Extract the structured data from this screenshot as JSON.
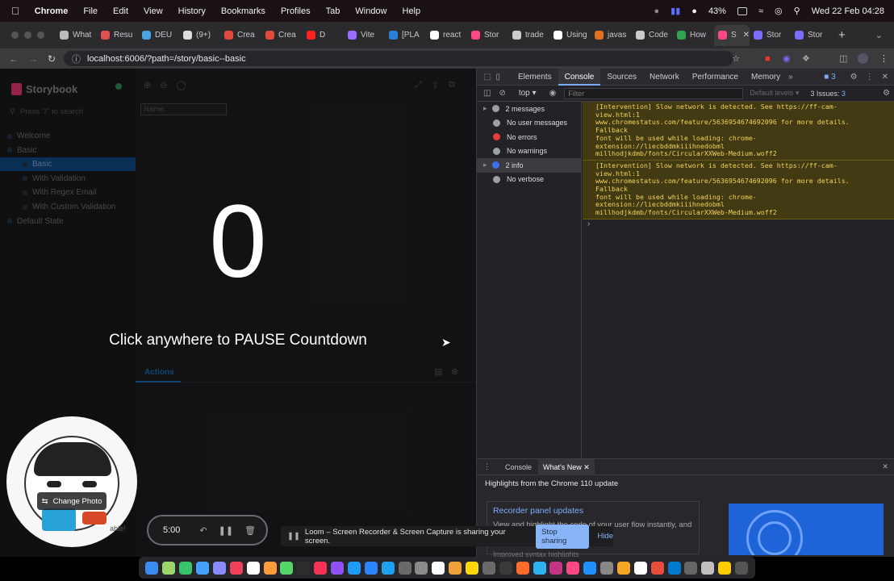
{
  "menubar": {
    "items": [
      "Chrome",
      "File",
      "Edit",
      "View",
      "History",
      "Bookmarks",
      "Profiles",
      "Tab",
      "Window",
      "Help"
    ],
    "battery": "43%",
    "datetime": "Wed 22 Feb  04:28"
  },
  "tabs": [
    {
      "label": "What",
      "color": "#bbbbbb"
    },
    {
      "label": "Resu",
      "color": "#e05050"
    },
    {
      "label": "DEU",
      "color": "#4aa3df"
    },
    {
      "label": "(9+)",
      "color": "#dddddd"
    },
    {
      "label": "Crea",
      "color": "#e24a3b"
    },
    {
      "label": "Crea",
      "color": "#e24a3b"
    },
    {
      "label": "D",
      "color": "#ff2020"
    },
    {
      "label": "Vite",
      "color": "#9a6bff"
    },
    {
      "label": "[PLA",
      "color": "#2b7fd9"
    },
    {
      "label": "react",
      "color": "#ffffff"
    },
    {
      "label": "Stor",
      "color": "#ff4785"
    },
    {
      "label": "trade",
      "color": "#cccccc"
    },
    {
      "label": "Using",
      "color": "#ffffff"
    },
    {
      "label": "javas",
      "color": "#e27020"
    },
    {
      "label": "Code",
      "color": "#cccccc"
    },
    {
      "label": "How",
      "color": "#2ea44f"
    },
    {
      "label": "S",
      "color": "#ff4785",
      "active": true
    },
    {
      "label": "Stor",
      "color": "#7c6cff"
    },
    {
      "label": "Stor",
      "color": "#7c6cff"
    }
  ],
  "address": {
    "url": "localhost:6006/?path=/story/basic--basic"
  },
  "storybook": {
    "logo": "Storybook",
    "search_placeholder": "Press \"/\" to search",
    "name_placeholder": "Name",
    "tree": [
      {
        "label": "Welcome",
        "indent": 0
      },
      {
        "label": "Basic",
        "indent": 0
      },
      {
        "label": "Basic",
        "indent": 1,
        "selected": true
      },
      {
        "label": "With Validation",
        "indent": 1
      },
      {
        "label": "With Regex Email",
        "indent": 1
      },
      {
        "label": "With Custom Validation",
        "indent": 1
      },
      {
        "label": "Default State",
        "indent": 0
      }
    ],
    "actions_tab": "Actions"
  },
  "overlay": {
    "countdown": "0",
    "hint": "Click anywhere to PAUSE Countdown"
  },
  "devtools": {
    "tabs": [
      "Elements",
      "Console",
      "Sources",
      "Network",
      "Performance",
      "Memory"
    ],
    "active_tab": "Console",
    "badge_count": "3",
    "context": "top",
    "filter_placeholder": "Filter",
    "levels": "Default levels",
    "issues": "3 Issues:",
    "issues_count": "3",
    "sidebar": [
      {
        "label": "2 messages",
        "color": "#9aa0a6",
        "caret": true
      },
      {
        "label": "No user messages",
        "color": "#9aa0a6"
      },
      {
        "label": "No errors",
        "color": "#e33e3e"
      },
      {
        "label": "No warnings",
        "color": "#9aa0a6"
      },
      {
        "label": "2 info",
        "color": "#3d6ee8",
        "caret": true,
        "selected": true
      },
      {
        "label": "No verbose",
        "color": "#9aa0a6"
      }
    ],
    "messages": [
      "[Intervention] Slow network is detected. See https://ff-cam-view.html:1\nwww.chromestatus.com/feature/5636954674692096 for more details. Fallback\nfont will be used while loading: chrome-extension://liecbddmkiiihnedobml\nmillhodjkdmb/fonts/CircularXXWeb-Medium.woff2",
      "[Intervention] Slow network is detected. See https://ff-cam-view.html:1\nwww.chromestatus.com/feature/5636954674692096 for more details. Fallback\nfont will be used while loading: chrome-extension://liecbddmkiiihnedobml\nmillhodjkdmb/fonts/CircularXXWeb-Medium.woff2"
    ],
    "drawer": {
      "tabs": [
        "Console",
        "What's New"
      ],
      "active": "What's New",
      "headline": "Highlights from the Chrome 110 update",
      "card_title": "Recorder panel updates",
      "card_text": "View and highlight the code of your user flow instantly, and",
      "card_more": "Improved syntax highlights"
    }
  },
  "loom": {
    "change_photo": "Change Photo",
    "timer": "5:00",
    "share_text": "Loom – Screen Recorder & Screen Capture is sharing your screen.",
    "stop_label": "Stop sharing",
    "hide_label": "Hide",
    "hidden_text": "able!"
  },
  "dock_colors": [
    "#3b8cf0",
    "#9ad66b",
    "#37c46b",
    "#46a0ff",
    "#8a8aff",
    "#ef3f5a",
    "#ffffff",
    "#ff9d3d",
    "#53d769",
    "#2d2d2d",
    "#fc3158",
    "#8e52f5",
    "#1c9cf5",
    "#2b84ff",
    "#1fa0f0",
    "#6a6a6a",
    "#8a8a8a",
    "#ffffff",
    "#f0a13a",
    "#ffd60a",
    "#6a6a6a",
    "#3a3a3a",
    "#ff6b2b",
    "#2db3f0",
    "#c13584",
    "#ff4785",
    "#1e90ff",
    "#888888",
    "#f5a623",
    "#ffffff",
    "#e74c3c",
    "#007acc",
    "#666666",
    "#c0c0c0",
    "#ffcc00",
    "#555555"
  ]
}
